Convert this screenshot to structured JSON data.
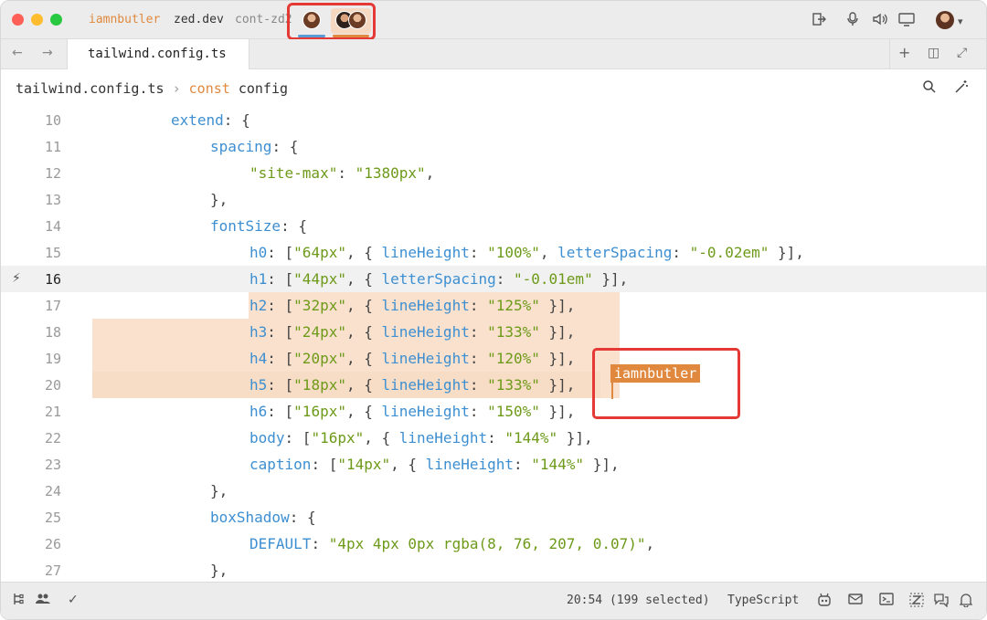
{
  "titlebar": {
    "user": "iamnbutler",
    "project": "zed.dev",
    "branch": "cont-zd2",
    "icons": [
      "leave-call-icon",
      "microphone-icon",
      "speaker-icon",
      "screen-share-icon",
      "avatar",
      "chevron-down-icon"
    ]
  },
  "tabs": {
    "back_glyph": "←",
    "forward_glyph": "→",
    "active_tab": "tailwind.config.ts",
    "right_icons": {
      "plus": "+",
      "split": "◫",
      "expand": "⤢"
    }
  },
  "breadcrumb": {
    "file": "tailwind.config.ts",
    "separator": "›",
    "keyword": "const",
    "symbol": "config"
  },
  "editor": {
    "active_line": 16,
    "lines": [
      {
        "n": "10",
        "indent": 2,
        "tokens": [
          [
            "prop",
            "extend"
          ],
          [
            "punc",
            ": {"
          ]
        ]
      },
      {
        "n": "11",
        "indent": 3,
        "tokens": [
          [
            "prop",
            "spacing"
          ],
          [
            "punc",
            ": {"
          ]
        ]
      },
      {
        "n": "12",
        "indent": 4,
        "tokens": [
          [
            "str",
            "\"site-max\""
          ],
          [
            "punc",
            ": "
          ],
          [
            "str",
            "\"1380px\""
          ],
          [
            "punc",
            ","
          ]
        ]
      },
      {
        "n": "13",
        "indent": 3,
        "tokens": [
          [
            "punc",
            "},"
          ]
        ]
      },
      {
        "n": "14",
        "indent": 3,
        "tokens": [
          [
            "prop",
            "fontSize"
          ],
          [
            "punc",
            ": {"
          ]
        ]
      },
      {
        "n": "15",
        "indent": 4,
        "tokens": [
          [
            "prop",
            "h0"
          ],
          [
            "punc",
            ": ["
          ],
          [
            "str",
            "\"64px\""
          ],
          [
            "punc",
            ", { "
          ],
          [
            "prop",
            "lineHeight"
          ],
          [
            "punc",
            ": "
          ],
          [
            "str",
            "\"100%\""
          ],
          [
            "punc",
            ", "
          ],
          [
            "prop",
            "letterSpacing"
          ],
          [
            "punc",
            ": "
          ],
          [
            "str",
            "\"-0.02em\""
          ],
          [
            "punc",
            " }],"
          ]
        ]
      },
      {
        "n": "16",
        "indent": 4,
        "tokens": [
          [
            "prop",
            "h1"
          ],
          [
            "punc",
            ": ["
          ],
          [
            "str",
            "\"44px\""
          ],
          [
            "punc",
            ", { "
          ],
          [
            "prop",
            "letterSpacing"
          ],
          [
            "punc",
            ": "
          ],
          [
            "str",
            "\"-0.01em\""
          ],
          [
            "punc",
            " }],"
          ]
        ]
      },
      {
        "n": "17",
        "indent": 4,
        "tokens": [
          [
            "prop",
            "h2"
          ],
          [
            "punc",
            ": ["
          ],
          [
            "str",
            "\"32px\""
          ],
          [
            "punc",
            ", { "
          ],
          [
            "prop",
            "lineHeight"
          ],
          [
            "punc",
            ": "
          ],
          [
            "str",
            "\"125%\""
          ],
          [
            "punc",
            " }],"
          ]
        ]
      },
      {
        "n": "18",
        "indent": 4,
        "tokens": [
          [
            "prop",
            "h3"
          ],
          [
            "punc",
            ": ["
          ],
          [
            "str",
            "\"24px\""
          ],
          [
            "punc",
            ", { "
          ],
          [
            "prop",
            "lineHeight"
          ],
          [
            "punc",
            ": "
          ],
          [
            "str",
            "\"133%\""
          ],
          [
            "punc",
            " }],"
          ]
        ]
      },
      {
        "n": "19",
        "indent": 4,
        "tokens": [
          [
            "prop",
            "h4"
          ],
          [
            "punc",
            ": ["
          ],
          [
            "str",
            "\"20px\""
          ],
          [
            "punc",
            ", { "
          ],
          [
            "prop",
            "lineHeight"
          ],
          [
            "punc",
            ": "
          ],
          [
            "str",
            "\"120%\""
          ],
          [
            "punc",
            " }],"
          ]
        ]
      },
      {
        "n": "20",
        "indent": 4,
        "tokens": [
          [
            "prop",
            "h5"
          ],
          [
            "punc",
            ": ["
          ],
          [
            "str",
            "\"18px\""
          ],
          [
            "punc",
            ", { "
          ],
          [
            "prop",
            "lineHeight"
          ],
          [
            "punc",
            ": "
          ],
          [
            "str",
            "\"133%\""
          ],
          [
            "punc",
            " }],"
          ]
        ]
      },
      {
        "n": "21",
        "indent": 4,
        "tokens": [
          [
            "prop",
            "h6"
          ],
          [
            "punc",
            ": ["
          ],
          [
            "str",
            "\"16px\""
          ],
          [
            "punc",
            ", { "
          ],
          [
            "prop",
            "lineHeight"
          ],
          [
            "punc",
            ": "
          ],
          [
            "str",
            "\"150%\""
          ],
          [
            "punc",
            " }],"
          ]
        ]
      },
      {
        "n": "22",
        "indent": 4,
        "tokens": [
          [
            "prop",
            "body"
          ],
          [
            "punc",
            ": ["
          ],
          [
            "str",
            "\"16px\""
          ],
          [
            "punc",
            ", { "
          ],
          [
            "prop",
            "lineHeight"
          ],
          [
            "punc",
            ": "
          ],
          [
            "str",
            "\"144%\""
          ],
          [
            "punc",
            " }],"
          ]
        ]
      },
      {
        "n": "23",
        "indent": 4,
        "tokens": [
          [
            "prop",
            "caption"
          ],
          [
            "punc",
            ": ["
          ],
          [
            "str",
            "\"14px\""
          ],
          [
            "punc",
            ", { "
          ],
          [
            "prop",
            "lineHeight"
          ],
          [
            "punc",
            ": "
          ],
          [
            "str",
            "\"144%\""
          ],
          [
            "punc",
            " }],"
          ]
        ]
      },
      {
        "n": "24",
        "indent": 3,
        "tokens": [
          [
            "punc",
            "},"
          ]
        ]
      },
      {
        "n": "25",
        "indent": 3,
        "tokens": [
          [
            "prop",
            "boxShadow"
          ],
          [
            "punc",
            ": {"
          ]
        ]
      },
      {
        "n": "26",
        "indent": 4,
        "tokens": [
          [
            "prop",
            "DEFAULT"
          ],
          [
            "punc",
            ": "
          ],
          [
            "str",
            "\"4px 4px 0px rgba(8, 76, 207, 0.07)\""
          ],
          [
            "punc",
            ","
          ]
        ]
      },
      {
        "n": "27",
        "indent": 3,
        "tokens": [
          [
            "punc",
            "},"
          ]
        ]
      }
    ],
    "collaborator_cursor": "iamnbutler"
  },
  "statusbar": {
    "position": "20:54 (199 selected)",
    "language": "TypeScript",
    "icons": [
      "project-tree-icon",
      "collab-icon",
      "diagnostics-check-icon",
      "assistant-icon",
      "feedback-icon",
      "terminal-icon",
      "zed-icon",
      "chat-icon",
      "notification-bell-icon"
    ]
  },
  "colors": {
    "property": "#3d8fd1",
    "string": "#6d9a19",
    "collaborator": "#e0893e",
    "selection": "#f8dcc4",
    "annotation": "#e53935"
  }
}
